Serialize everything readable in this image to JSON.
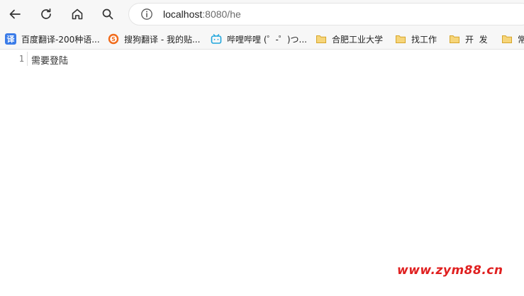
{
  "browser": {
    "url_host": "localhost",
    "url_rest": ":8080/he"
  },
  "bookmarks": [
    {
      "label": "百度翻译-200种语...",
      "icon": "baidu-translate-icon",
      "color": "#3b7ce8"
    },
    {
      "label": "搜狗翻译 - 我的贴...",
      "icon": "sogou-icon",
      "color": "#f06a1a"
    },
    {
      "label": "哔哩哔哩 (゜-゜)つ...",
      "icon": "bilibili-icon",
      "color": "#1fa5dc"
    },
    {
      "label": "合肥工业大学",
      "icon": "folder-icon",
      "color": "#f2c34a"
    },
    {
      "label": "找工作",
      "icon": "folder-icon",
      "color": "#f2c34a"
    },
    {
      "label": "开  发",
      "icon": "folder-icon",
      "color": "#f2c34a"
    },
    {
      "label": "常",
      "icon": "folder-icon",
      "color": "#f2c34a"
    }
  ],
  "editor": {
    "line_number": "1",
    "line_text": "需要登陆"
  },
  "watermark": "www.zym88.cn"
}
